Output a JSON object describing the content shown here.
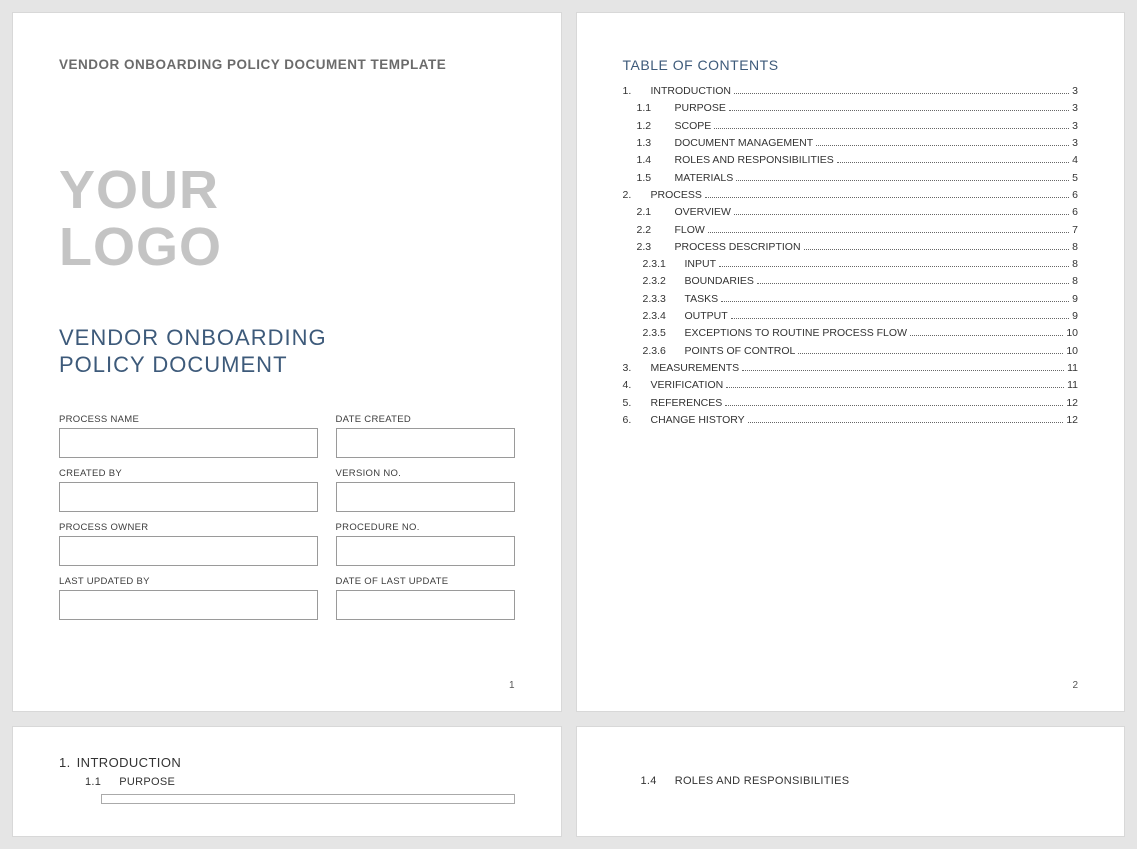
{
  "cover": {
    "header": "VENDOR ONBOARDING POLICY DOCUMENT TEMPLATE",
    "logo_line1": "YOUR",
    "logo_line2": "LOGO",
    "title_line1": "VENDOR ONBOARDING",
    "title_line2": "POLICY DOCUMENT",
    "fields": [
      {
        "label": "PROCESS NAME"
      },
      {
        "label": "DATE CREATED"
      },
      {
        "label": "CREATED BY"
      },
      {
        "label": "VERSION NO."
      },
      {
        "label": "PROCESS OWNER"
      },
      {
        "label": "PROCEDURE NO."
      },
      {
        "label": "LAST UPDATED BY"
      },
      {
        "label": "DATE OF LAST UPDATE"
      }
    ],
    "page_num": "1"
  },
  "toc": {
    "title": "TABLE OF CONTENTS",
    "items": [
      {
        "num": "1.",
        "label": "INTRODUCTION",
        "page": "3",
        "lvl": 0
      },
      {
        "num": "1.1",
        "label": "PURPOSE",
        "page": "3",
        "lvl": 1
      },
      {
        "num": "1.2",
        "label": "SCOPE",
        "page": "3",
        "lvl": 1
      },
      {
        "num": "1.3",
        "label": "DOCUMENT MANAGEMENT",
        "page": "3",
        "lvl": 1
      },
      {
        "num": "1.4",
        "label": "ROLES AND RESPONSIBILITIES",
        "page": "4",
        "lvl": 1
      },
      {
        "num": "1.5",
        "label": "MATERIALS",
        "page": "5",
        "lvl": 1
      },
      {
        "num": "2.",
        "label": "PROCESS",
        "page": "6",
        "lvl": 0
      },
      {
        "num": "2.1",
        "label": "OVERVIEW",
        "page": "6",
        "lvl": 1
      },
      {
        "num": "2.2",
        "label": "FLOW",
        "page": "7",
        "lvl": 1
      },
      {
        "num": "2.3",
        "label": "PROCESS DESCRIPTION",
        "page": "8",
        "lvl": 1
      },
      {
        "num": "2.3.1",
        "label": "INPUT",
        "page": "8",
        "lvl": 2
      },
      {
        "num": "2.3.2",
        "label": "BOUNDARIES",
        "page": "8",
        "lvl": 2
      },
      {
        "num": "2.3.3",
        "label": "TASKS",
        "page": "9",
        "lvl": 2
      },
      {
        "num": "2.3.4",
        "label": "OUTPUT",
        "page": "9",
        "lvl": 2
      },
      {
        "num": "2.3.5",
        "label": "EXCEPTIONS TO ROUTINE PROCESS FLOW",
        "page": "10",
        "lvl": 2
      },
      {
        "num": "2.3.6",
        "label": "POINTS OF CONTROL",
        "page": "10",
        "lvl": 2
      },
      {
        "num": "3.",
        "label": "MEASUREMENTS",
        "page": "11",
        "lvl": 0
      },
      {
        "num": "4.",
        "label": "VERIFICATION",
        "page": "11",
        "lvl": 0
      },
      {
        "num": "5.",
        "label": "REFERENCES",
        "page": "12",
        "lvl": 0
      },
      {
        "num": "6.",
        "label": "CHANGE HISTORY",
        "page": "12",
        "lvl": 0
      }
    ],
    "page_num": "2"
  },
  "page3": {
    "h1_num": "1.",
    "h1_label": "INTRODUCTION",
    "h2_num": "1.1",
    "h2_label": "PURPOSE"
  },
  "page4": {
    "h2_num": "1.4",
    "h2_label": "ROLES AND RESPONSIBILITIES"
  }
}
